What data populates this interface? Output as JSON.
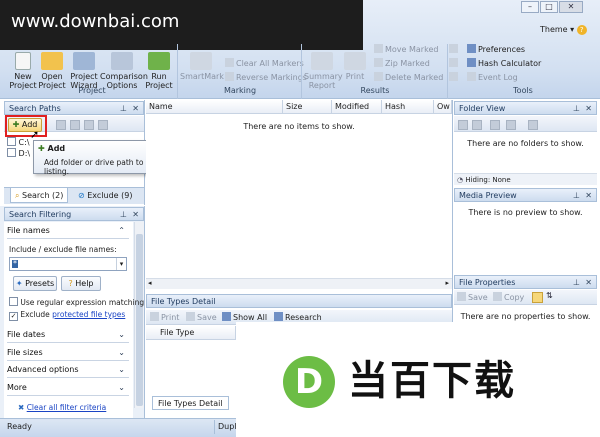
{
  "watermark_top": "www.downbai.com",
  "window": {
    "theme_label": "Theme",
    "help_glyph": "?",
    "min_glyph": "–",
    "max_glyph": "□",
    "close_glyph": "✕"
  },
  "ribbon": {
    "project": {
      "new": [
        "New",
        "Project"
      ],
      "open": [
        "Open",
        "Project"
      ],
      "wizard": [
        "Project",
        "Wizard"
      ],
      "comparison": [
        "Comparison",
        "Options"
      ],
      "run": [
        "Run",
        "Project"
      ],
      "group": "Project"
    },
    "marking": {
      "smartmark": "SmartMark",
      "clear_all": "Clear All Markers",
      "reverse": "Reverse Markings",
      "group": "Marking"
    },
    "results": {
      "summary": [
        "Summary",
        "Report"
      ],
      "print": "Print",
      "move": "Move Marked",
      "zip": "Zip Marked",
      "delete": "Delete Marked",
      "group": "Results"
    },
    "tools": {
      "preferences": "Preferences",
      "hash_calc": "Hash Calculator",
      "event_log": "Event Log",
      "group": "Tools"
    }
  },
  "search_paths": {
    "title": "Search Paths",
    "add_button": "Add",
    "paths": [
      "C:\\",
      "D:\\"
    ],
    "tooltip_title": "Add",
    "tooltip_text": "Add folder or drive path to this listing.",
    "tab_search": "Search (2)",
    "tab_exclude": "Exclude (9)"
  },
  "search_filtering": {
    "title": "Search Filtering",
    "file_names": "File names",
    "include_label": "Include / exclude file names:",
    "input_value": "*",
    "presets": "Presets",
    "help": "Help",
    "regex_label": "Use regular expression matching",
    "exclude_label": "Exclude",
    "exclude_link": "protected file types",
    "sections": [
      "File dates",
      "File sizes",
      "Advanced options",
      "More"
    ],
    "clear_link": "Clear all filter criteria"
  },
  "results_list": {
    "columns": [
      "Name",
      "Size",
      "Modified",
      "Hash",
      "Ow"
    ],
    "empty": "There are no items to show."
  },
  "file_types": {
    "title": "File Types Detail",
    "print": "Print",
    "save": "Save",
    "show_all": "Show All",
    "research": "Research",
    "columns": [
      "File Type",
      "Ex"
    ],
    "tab": "File Types Detail"
  },
  "folder_view": {
    "title": "Folder View",
    "empty": "There are no folders to show.",
    "hiding": "Hiding: None"
  },
  "media_preview": {
    "title": "Media Preview",
    "empty": "There is no preview to show."
  },
  "file_properties": {
    "title": "File Properties",
    "save": "Save",
    "copy": "Copy",
    "empty": "There are no properties to show."
  },
  "status_bar": {
    "ready": "Ready",
    "dupli": "Dupli"
  },
  "watermark_bottom": {
    "letter": "D",
    "text": "当百下载"
  },
  "colors": {
    "highlight": "#e02020",
    "ribbon": "#d3e0f1",
    "logo_green": "#6cbd45"
  }
}
